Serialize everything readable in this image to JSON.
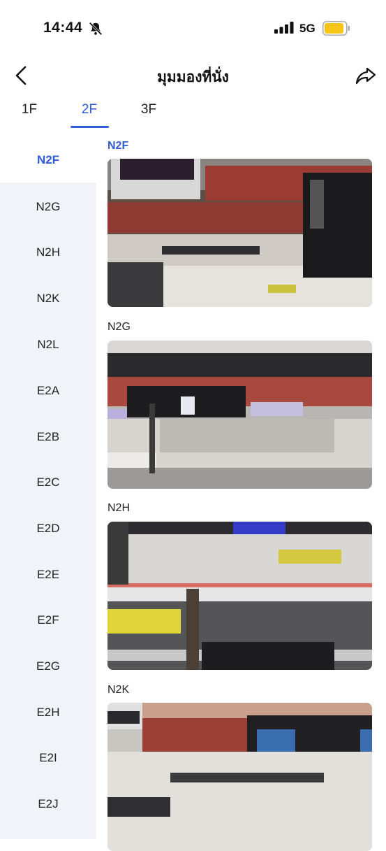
{
  "status_bar": {
    "time": "14:44",
    "network": "5G"
  },
  "header": {
    "title": "มุมมองที่นั่ง"
  },
  "floor_tabs": [
    {
      "label": "1F",
      "active": false
    },
    {
      "label": "2F",
      "active": true
    },
    {
      "label": "3F",
      "active": false
    }
  ],
  "sidebar": {
    "items": [
      {
        "label": "N2F",
        "active": true
      },
      {
        "label": "N2G"
      },
      {
        "label": "N2H"
      },
      {
        "label": "N2K"
      },
      {
        "label": "N2L"
      },
      {
        "label": "E2A"
      },
      {
        "label": "E2B"
      },
      {
        "label": "E2C"
      },
      {
        "label": "E2D"
      },
      {
        "label": "E2E"
      },
      {
        "label": "E2F"
      },
      {
        "label": "E2G"
      },
      {
        "label": "E2H"
      },
      {
        "label": "E2I"
      },
      {
        "label": "E2J"
      }
    ]
  },
  "sections": [
    {
      "label": "N2F",
      "active": true
    },
    {
      "label": "N2G"
    },
    {
      "label": "N2H"
    },
    {
      "label": "N2K"
    }
  ],
  "colors": {
    "accent": "#2f5bd6",
    "sidebar_bg": "#f2f3f8",
    "battery": "#f5c518"
  },
  "icons": [
    "bell-slash-icon",
    "signal-icon",
    "battery-icon",
    "back-chevron-icon",
    "share-arrow-icon"
  ]
}
